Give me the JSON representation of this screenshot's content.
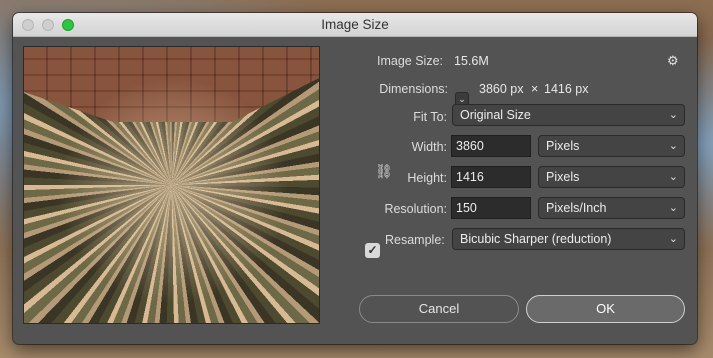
{
  "window": {
    "title": "Image Size"
  },
  "image_size": {
    "label": "Image Size:",
    "value": "15.6M"
  },
  "gear_menu": {
    "icon": "gear-icon",
    "glyph": "⚙"
  },
  "dimensions": {
    "label": "Dimensions:",
    "toggle_glyph": "⌄",
    "width": "3860 px",
    "separator": "×",
    "height": "1416 px"
  },
  "fit_to": {
    "label": "Fit To:",
    "selected": "Original Size"
  },
  "width": {
    "label": "Width:",
    "value": "3860",
    "unit": "Pixels"
  },
  "height": {
    "label": "Height:",
    "value": "1416",
    "unit": "Pixels"
  },
  "link_icon": {
    "icon": "chain-link-icon",
    "glyph": "⛓"
  },
  "resolution": {
    "label": "Resolution:",
    "value": "150",
    "unit": "Pixels/Inch"
  },
  "resample": {
    "label": "Resample:",
    "checked": true,
    "check_glyph": "✓",
    "selected": "Bicubic Sharper (reduction)"
  },
  "chevron": "⌄",
  "buttons": {
    "cancel": "Cancel",
    "ok": "OK"
  },
  "colors": {
    "dialog_bg": "#535353",
    "titlebar": "#d6d6d6",
    "zoom_button": "#2fc443"
  }
}
